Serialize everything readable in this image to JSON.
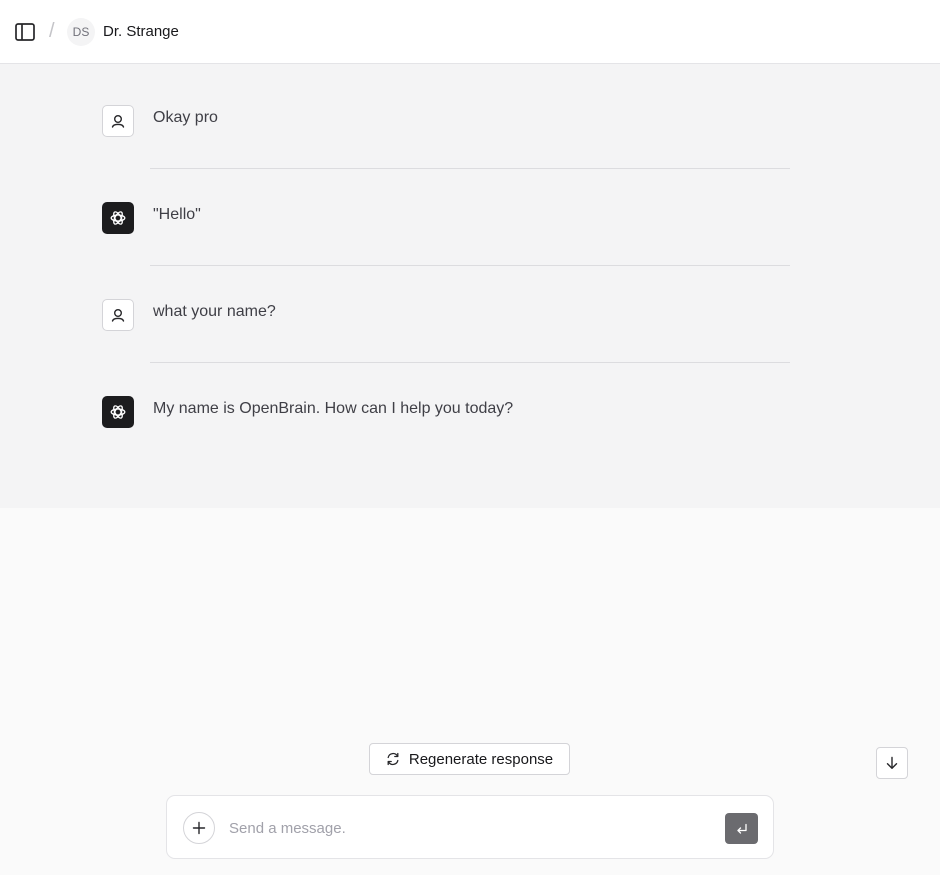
{
  "header": {
    "avatar_initials": "DS",
    "user_name": "Dr. Strange"
  },
  "messages": [
    {
      "role": "user",
      "icon": "user-icon",
      "text": "Okay pro"
    },
    {
      "role": "assistant",
      "icon": "openai-logo-icon",
      "text": "\"Hello\""
    },
    {
      "role": "user",
      "icon": "user-icon",
      "text": "what your name?"
    },
    {
      "role": "assistant",
      "icon": "openai-logo-icon",
      "text": "My name is OpenBrain. How can I help you today?"
    }
  ],
  "actions": {
    "regenerate_label": "Regenerate response"
  },
  "composer": {
    "placeholder": "Send a message.",
    "value": ""
  },
  "colors": {
    "background": "#fafafa",
    "chat_background": "#f4f4f5",
    "assistant_icon_bg": "#1c1c1e",
    "send_button": "#6b6b6f"
  }
}
